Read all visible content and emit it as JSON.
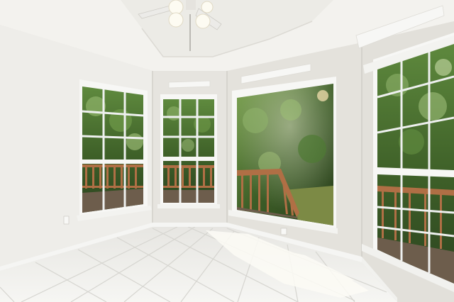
{
  "scene": {
    "subject": "empty sunroom",
    "colors": {
      "wall_left": "#eeede9",
      "wall_center": "#e6e4df",
      "wall_right": "#e2e0da",
      "ceiling": "#f3f2ee",
      "tray_ceiling": "#ecebe6",
      "trim": "#f5f5f3",
      "window_frame": "#f7f7f5",
      "mullion": "#eef0ef",
      "foliage_dark": "#2f4a22",
      "foliage_mid": "#4d7236",
      "foliage_light": "#8fb26a",
      "deck_rail": "#b06f45",
      "deck_floor": "#6d5d4c",
      "lawn": "#7c8a45",
      "tile": "#f2f2ef",
      "grout": "#d6d5d0",
      "sunlight": "#fdfcf6"
    }
  }
}
